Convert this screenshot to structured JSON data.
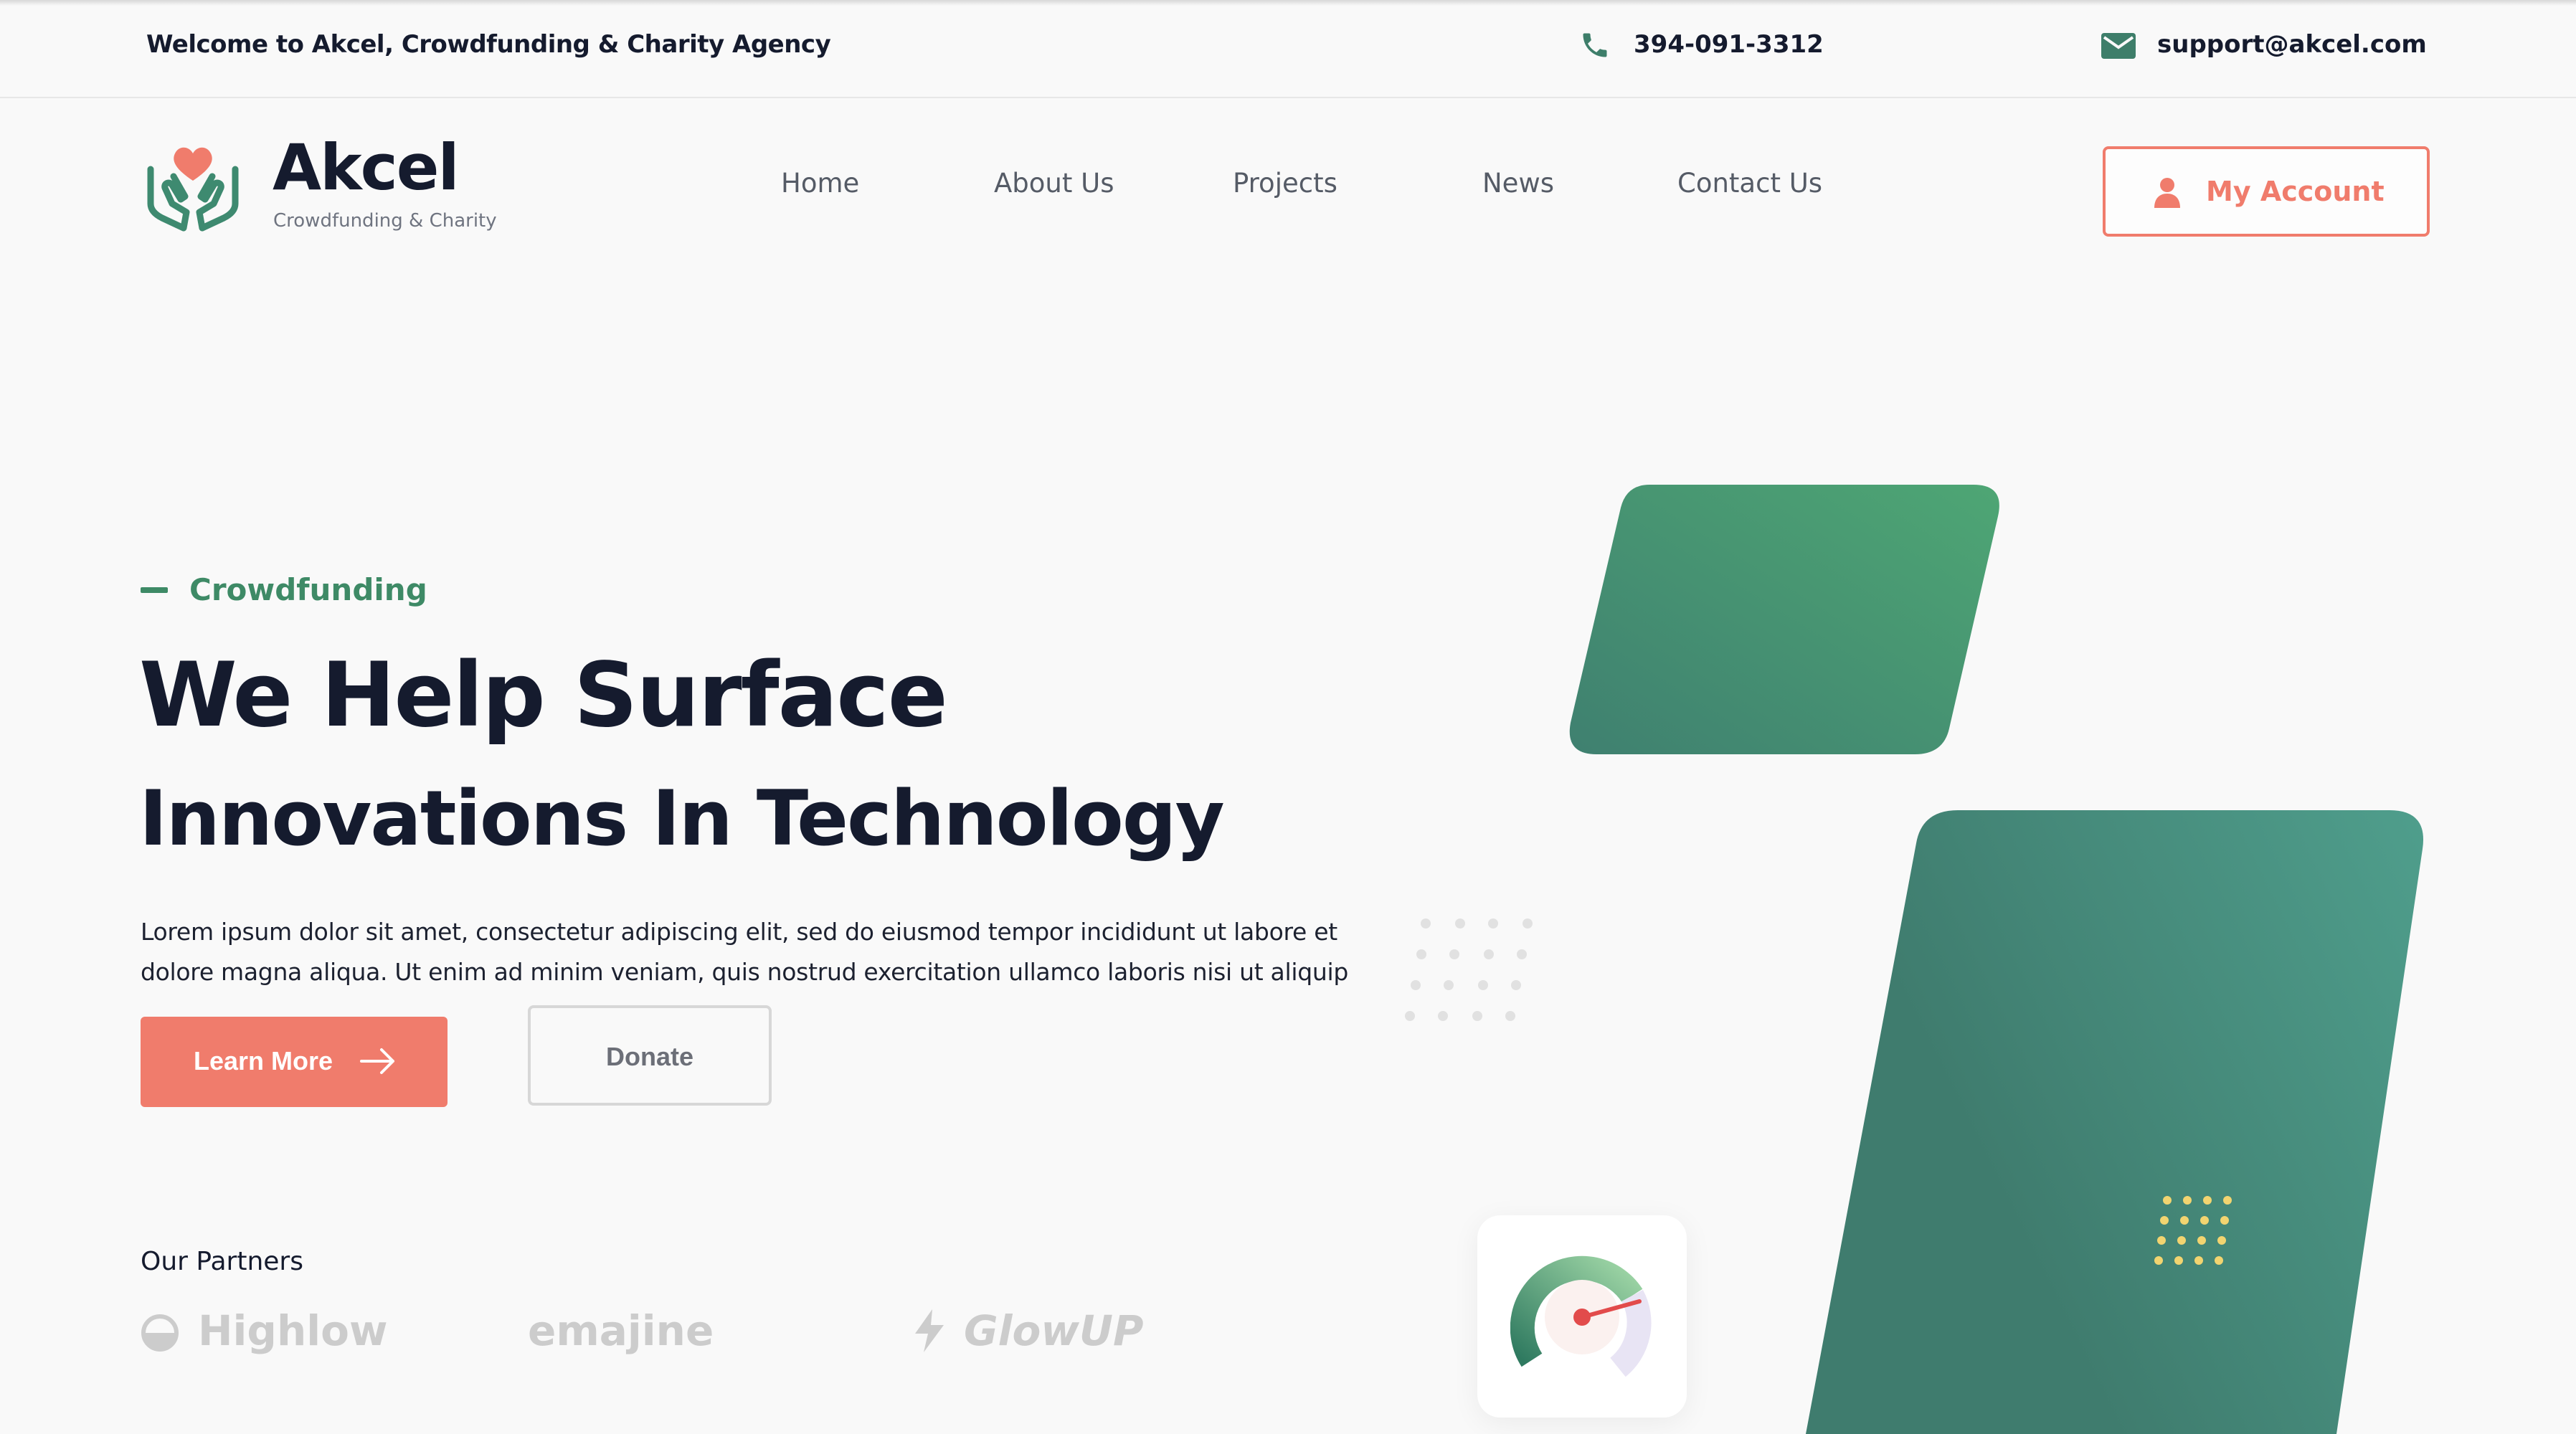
{
  "topbar": {
    "welcome": "Welcome to Akcel, Crowdfunding & Charity Agency",
    "phone": "394-091-3312",
    "phone_icon": "phone-icon",
    "email": "support@akcel.com",
    "email_icon": "mail-icon"
  },
  "brand": {
    "name": "Akcel",
    "tagline": "Crowdfunding & Charity",
    "logo_icon": "heart-hands-icon"
  },
  "nav": {
    "items": [
      "Home",
      "About Us",
      "Projects",
      "News",
      "Contact Us"
    ]
  },
  "account": {
    "label": "My Account",
    "icon": "user-icon"
  },
  "hero": {
    "eyebrow": "Crowdfunding",
    "title_line1": "We Help Surface",
    "title_line2": "Innovations In Technology",
    "description": "Lorem ipsum dolor sit amet, consectetur adipiscing elit, sed do eiusmod tempor incididunt ut labore et dolore magna aliqua. Ut enim ad minim veniam, quis nostrud exercitation ullamco laboris nisi ut aliquip",
    "primary_button": "Learn More",
    "secondary_button": "Donate"
  },
  "partners": {
    "title": "Our Partners",
    "logos": [
      "Highlow",
      "emajine",
      "GlowUP"
    ]
  },
  "colors": {
    "accent": "#f07c6c",
    "brand_green": "#3e8a66",
    "text_dark": "#151b2e"
  }
}
